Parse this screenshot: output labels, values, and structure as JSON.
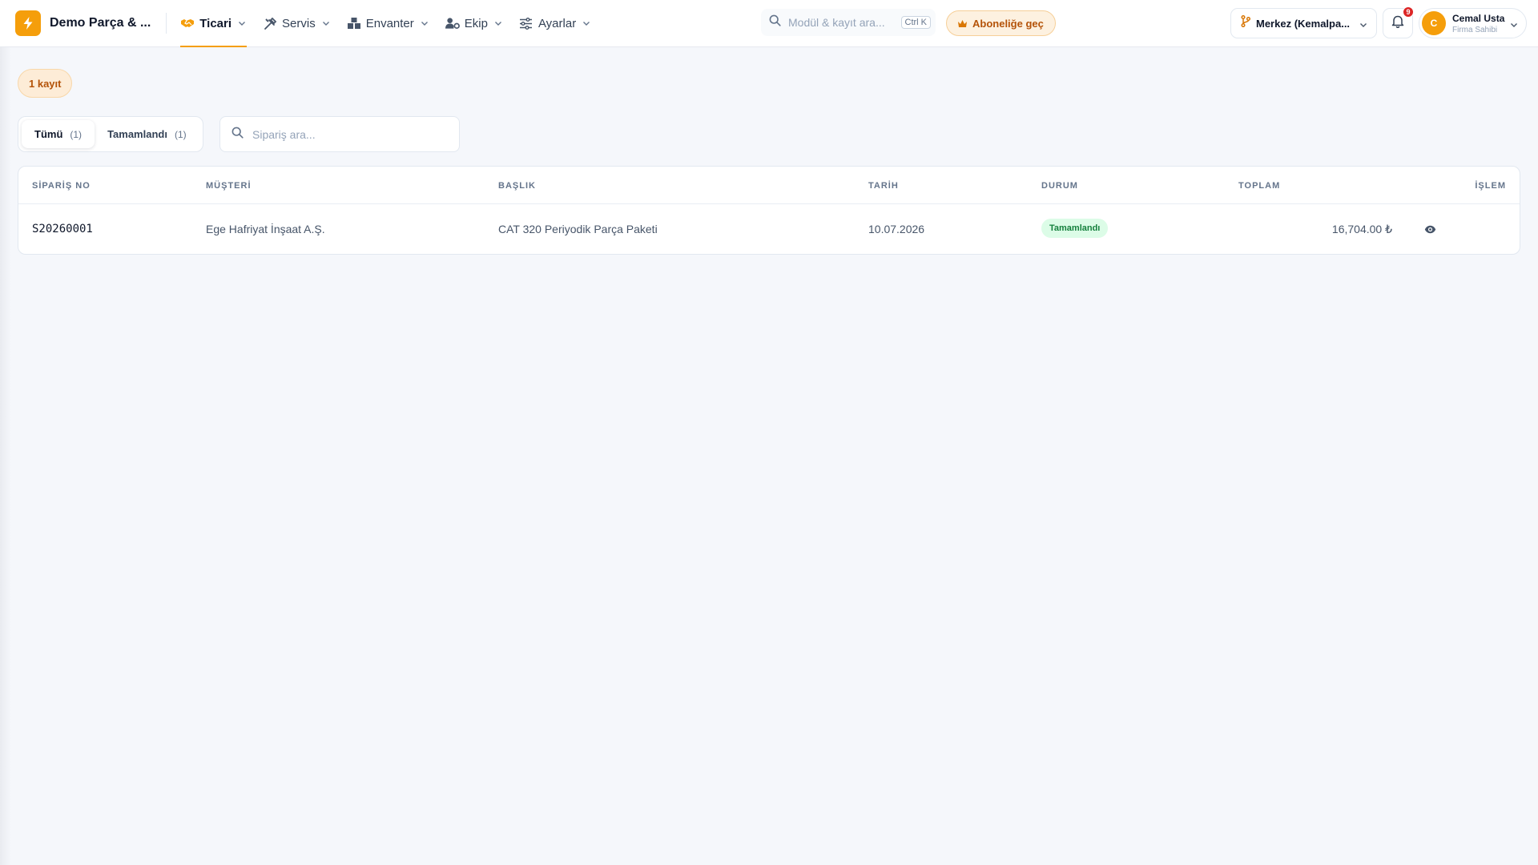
{
  "app": {
    "company_name": "Demo Parça & ...",
    "nav": [
      {
        "label": "Ticari",
        "icon": "handshake-icon",
        "active": true
      },
      {
        "label": "Servis",
        "icon": "tools-icon",
        "active": false
      },
      {
        "label": "Envanter",
        "icon": "boxes-icon",
        "active": false
      },
      {
        "label": "Ekip",
        "icon": "users-cog-icon",
        "active": false
      },
      {
        "label": "Ayarlar",
        "icon": "sliders-icon",
        "active": false
      }
    ],
    "search": {
      "placeholder": "Modül & kayıt ara...",
      "shortcut": "Ctrl K"
    },
    "upgrade_label": "Aboneliğe geç",
    "branch_label": "Merkez (Kemalpa...",
    "notifications_count": "9",
    "user": {
      "initial": "C",
      "name": "Cemal Usta",
      "role": "Firma Sahibi"
    },
    "accent_color": "#f59e0b"
  },
  "page": {
    "record_count": "1 kayıt",
    "tabs": [
      {
        "label": "Tümü",
        "count": "(1)",
        "active": true
      },
      {
        "label": "Tamamlandı",
        "count": "(1)",
        "active": false
      }
    ],
    "search_placeholder": "Sipariş ara...",
    "table": {
      "headers": {
        "order_no": "SİPARİŞ NO",
        "customer": "MÜŞTERİ",
        "title": "BAŞLIK",
        "date": "TARİH",
        "status": "DURUM",
        "total": "TOPLAM",
        "action": "İŞLEM"
      },
      "rows": [
        {
          "order_no": "S20260001",
          "customer": "Ege Hafriyat İnşaat A.Ş.",
          "title": "CAT 320 Periyodik Parça Paketi",
          "date": "10.07.2026",
          "status": "Tamamlandı",
          "total": "16,704.00 ₺",
          "action_icon": "eye-icon"
        }
      ]
    }
  }
}
